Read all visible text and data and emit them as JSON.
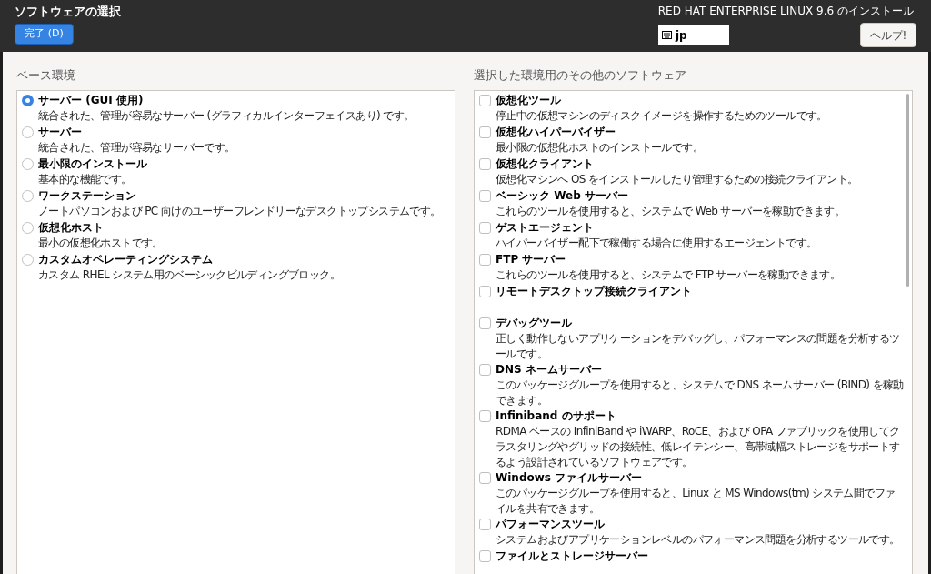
{
  "header": {
    "title": "ソフトウェアの選択",
    "done_button": "完了 (D)",
    "product": "RED HAT ENTERPRISE LINUX 9.6 のインストール",
    "keyboard_layout": "jp",
    "help_button": "ヘルプ!"
  },
  "base_environment": {
    "heading": "ベース環境",
    "items": [
      {
        "name": "サーバー (GUI 使用)",
        "description": "統合された、管理が容易なサーバー (グラフィカルインターフェイスあり) です。",
        "selected": true
      },
      {
        "name": "サーバー",
        "description": "統合された、管理が容易なサーバーです。",
        "selected": false
      },
      {
        "name": "最小限のインストール",
        "description": "基本的な機能です。",
        "selected": false
      },
      {
        "name": "ワークステーション",
        "description": "ノートパソコンおよび PC 向けのユーザーフレンドリーなデスクトップシステムです。",
        "selected": false
      },
      {
        "name": "仮想化ホスト",
        "description": "最小の仮想化ホストです。",
        "selected": false
      },
      {
        "name": "カスタムオペレーティングシステム",
        "description": "カスタム RHEL システム用のベーシックビルディングブロック。",
        "selected": false
      }
    ]
  },
  "additional_software": {
    "heading": "選択した環境用のその他のソフトウェア",
    "items": [
      {
        "name": "仮想化ツール",
        "description": "停止中の仮想マシンのディスクイメージを操作するためのツールです。",
        "checked": false
      },
      {
        "name": "仮想化ハイパーバイザー",
        "description": "最小限の仮想化ホストのインストールです。",
        "checked": false
      },
      {
        "name": "仮想化クライアント",
        "description": "仮想化マシンへ OS をインストールしたり管理するための接続クライアント。",
        "checked": false
      },
      {
        "name": "ベーシック Web サーバー",
        "description": "これらのツールを使用すると、システムで Web サーバーを稼動できます。",
        "checked": false
      },
      {
        "name": "ゲストエージェント",
        "description": "ハイパーバイザー配下で稼働する場合に使用するエージェントです。",
        "checked": false
      },
      {
        "name": "FTP サーバー",
        "description": "これらのツールを使用すると、システムで FTP サーバーを稼動できます。",
        "checked": false
      },
      {
        "name": "リモートデスクトップ接続クライアント",
        "checked": false
      },
      {
        "name": "デバッグツール",
        "description": "正しく動作しないアプリケーションをデバッグし、パフォーマンスの問題を分析するツールです。",
        "checked": false
      },
      {
        "name": "DNS ネームサーバー",
        "description": "このパッケージグループを使用すると、システムで DNS ネームサーバー (BIND) を稼動できます。",
        "checked": false
      },
      {
        "name": "Infiniband のサポート",
        "description": "RDMA ベースの InfiniBand や iWARP、RoCE、および OPA ファブリックを使用してクラスタリングやグリッドの接続性、低レイテンシー、高帯域幅ストレージをサポートするよう設計されているソフトウェアです。",
        "checked": false
      },
      {
        "name": "Windows ファイルサーバー",
        "description": "このパッケージグループを使用すると、Linux と MS Windows(tm) システム間でファイルを共有できます。",
        "checked": false
      },
      {
        "name": "パフォーマンスツール",
        "description": "システムおよびアプリケーションレベルのパフォーマンス問題を分析するツールです。",
        "checked": false
      },
      {
        "name": "ファイルとストレージサーバー",
        "checked": false
      }
    ]
  }
}
